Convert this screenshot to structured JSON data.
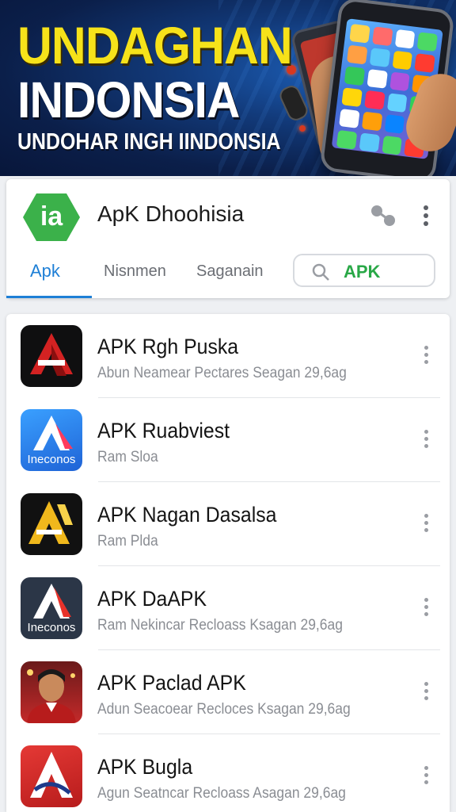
{
  "banner": {
    "title_line1": "UNDAGHAN",
    "title_line2": "INDONSIA",
    "subtitle": "UNDOHAR INGH IINDONSIA"
  },
  "header": {
    "logo_text": "ia",
    "app_title": "ApK Dhoohisia",
    "tabs": [
      {
        "label": "Apk",
        "active": true
      },
      {
        "label": "Nisnmen",
        "active": false
      },
      {
        "label": "Saganain",
        "active": false
      }
    ],
    "search_value": "APK"
  },
  "apps": [
    {
      "name": "APK Rgh Puska",
      "description": "Abun Neamear Pectares Seagan 29,6ag",
      "icon": "red-a-on-black-icon",
      "icon_caption": ""
    },
    {
      "name": "APK Ruabviest",
      "description": "Ram Sloa",
      "icon": "white-a-on-blue-icon",
      "icon_caption": "Ineconos"
    },
    {
      "name": "APK Nagan Dasalsa",
      "description": "Ram Plda",
      "icon": "gold-a-on-black-icon",
      "icon_caption": ""
    },
    {
      "name": "APK DaAPK",
      "description": "Ram Nekincar Recloass Ksagan 29,6ag",
      "icon": "red-a-on-slate-icon",
      "icon_caption": "Ineconos"
    },
    {
      "name": "APK Paclad APK",
      "description": "Adun Seacoear Recloces Ksagan 29,6ag",
      "icon": "person-photo-icon",
      "icon_caption": ""
    },
    {
      "name": "APK Bugla",
      "description": "Agun Seatncar Recloass Asagan 29,6ag",
      "icon": "white-a-on-red-icon",
      "icon_caption": ""
    }
  ],
  "colors": {
    "accent": "#1e7fd6",
    "search_text": "#29a847",
    "banner_yellow": "#f6e21a",
    "logo_green": "#3bb14a"
  }
}
